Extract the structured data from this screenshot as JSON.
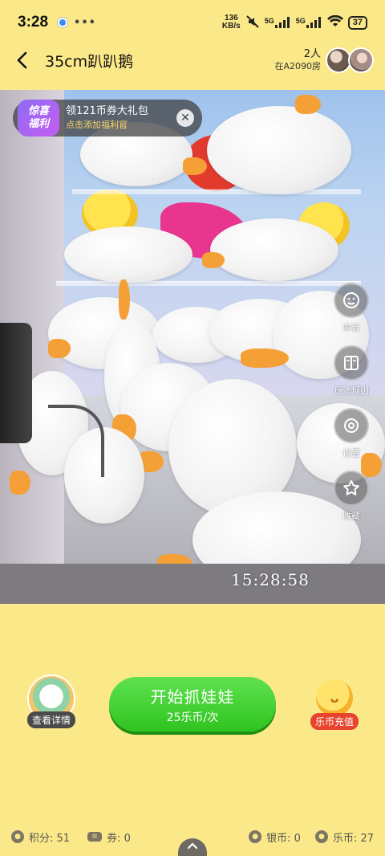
{
  "status_bar": {
    "time": "3:28",
    "net_speed_value": "136",
    "net_speed_unit": "KB/s",
    "sim1": "5G",
    "sim2": "5G",
    "battery": "37"
  },
  "header": {
    "title": "35cm趴趴鹅",
    "viewer_count": "2人",
    "room": "在A2090房"
  },
  "promo": {
    "badge_line1": "惊喜",
    "badge_line2": "福利",
    "title": "领121币券大礼包",
    "subtitle": "点击添加福利官"
  },
  "video": {
    "timestamp": "15:28:58"
  },
  "side_actions": [
    {
      "label": "申诉",
      "icon": "smiley-face-icon"
    },
    {
      "label": "玩法规则",
      "icon": "book-icon"
    },
    {
      "label": "设置",
      "icon": "gear-icon"
    },
    {
      "label": "收藏",
      "icon": "star-icon"
    }
  ],
  "controls": {
    "details_label": "查看详情",
    "start_label": "开始抓娃娃",
    "start_price": "25乐币/次",
    "recharge_label": "乐币充值"
  },
  "bottom_bar": {
    "points": "积分: 51",
    "coupons": "券: 0",
    "silver": "银币: 0",
    "lebi": "乐币: 27"
  }
}
